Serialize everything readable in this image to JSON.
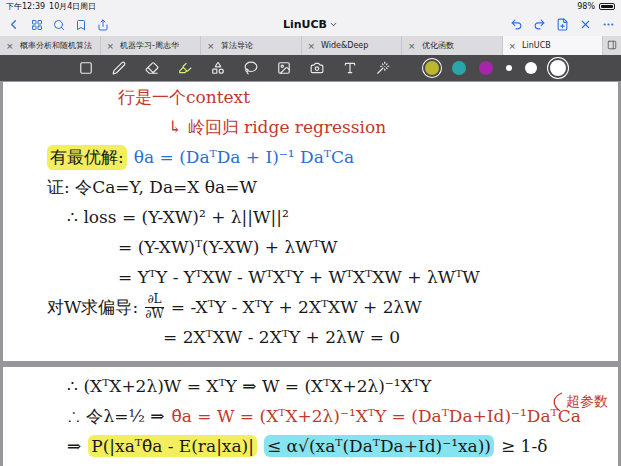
{
  "status_bar": {
    "time": "下午12:39",
    "date": "10月4日周日",
    "battery": "98%",
    "level": 0.98
  },
  "nav": {
    "title": "LinUCB"
  },
  "tab_close": "×",
  "tabs": [
    {
      "label": "概率分析和随机算法",
      "selected": false
    },
    {
      "label": "机器学习-周志华",
      "selected": false
    },
    {
      "label": "算法导论",
      "selected": false
    },
    {
      "label": "Wide&Deep",
      "selected": false
    },
    {
      "label": "优化函数",
      "selected": false
    },
    {
      "label": "LinUCB",
      "selected": true
    }
  ],
  "tools": [
    {
      "kind": "zoom",
      "selected": false
    },
    {
      "kind": "pen",
      "selected": false
    },
    {
      "kind": "eraser",
      "selected": false
    },
    {
      "kind": "highlighter",
      "selected": true
    },
    {
      "kind": "shapes",
      "selected": false
    },
    {
      "kind": "lasso",
      "selected": false
    },
    {
      "kind": "image",
      "selected": false
    },
    {
      "kind": "camera",
      "selected": false
    },
    {
      "kind": "text",
      "selected": false
    },
    {
      "kind": "laser",
      "selected": false
    }
  ],
  "pen_colors": [
    {
      "color": "#bcb52e",
      "selected": true
    },
    {
      "color": "#2aa6aa",
      "selected": false
    },
    {
      "color": "#a526a8",
      "selected": false
    }
  ],
  "pen_widths": [
    {
      "kind": "small",
      "selected": false
    },
    {
      "kind": "medium",
      "selected": false
    },
    {
      "kind": "large",
      "selected": true
    }
  ],
  "pages": [
    {
      "lines": [
        {
          "kind": "cont",
          "segments": [
            {
              "text": "行是一个context",
              "color": "#c0392b"
            }
          ]
        },
        {
          "kind": "note",
          "segments": [
            {
              "text": "↳ 岭回归 ridge regression",
              "color": "#c0392b"
            }
          ]
        },
        {
          "kind": "line",
          "segments": [
            {
              "text": "有最优解:",
              "color": "#1a1a1a",
              "highlight": "#f2ee5e"
            },
            {
              "text": "θa = (DaᵀDa + I)⁻¹ DaᵀCa",
              "color": "#2b6fd0"
            }
          ]
        },
        {
          "kind": "line",
          "segments": [
            {
              "text": "证: 令Ca=Y, Da=X  θa=W",
              "color": "#1a1a1a"
            }
          ]
        },
        {
          "kind": "sub",
          "segments": [
            {
              "text": "∴ loss = (Y-XW)² + λ||W||²",
              "color": "#1a1a1a"
            }
          ]
        },
        {
          "kind": "cont",
          "segments": [
            {
              "text": "= (Y-XW)ᵀ(Y-XW) + λWᵀW",
              "color": "#1a1a1a"
            }
          ]
        },
        {
          "kind": "cont",
          "segments": [
            {
              "text": "= YᵀY - YᵀXW - WᵀXᵀY + WᵀXᵀXW + λWᵀW",
              "color": "#1a1a1a"
            }
          ]
        },
        {
          "kind": "line",
          "segments": [
            {
              "text": "对W求偏导:",
              "color": "#1a1a1a"
            },
            {
              "num": "∂L",
              "den": "∂W",
              "color": "#1a1a1a"
            },
            {
              "text": "= -XᵀY - XᵀY + 2XᵀXW + 2λW",
              "color": "#1a1a1a"
            }
          ]
        },
        {
          "kind": "deep",
          "segments": [
            {
              "text": "= 2XᵀXW - 2XᵀY + 2λW = 0",
              "color": "#1a1a1a"
            }
          ]
        }
      ]
    },
    {
      "annotation": {
        "text": "超参数",
        "color": "#c0392b"
      },
      "lines": [
        {
          "kind": "sub",
          "segments": [
            {
              "text": "∴ (XᵀX+2λ)W = XᵀY  ⇒  W = (XᵀX+2λ)⁻¹XᵀY",
              "color": "#1a1a1a"
            }
          ]
        },
        {
          "kind": "sub",
          "segments": [
            {
              "text": "∴ 令λ=½ ⇒",
              "color": "#1a1a1a"
            },
            {
              "text": "θ̂a = W = (XᵀX+2λ)⁻¹XᵀY = (DaᵀDa+Id)⁻¹DaᵀCa",
              "color": "#c0392b"
            }
          ]
        },
        {
          "kind": "sub",
          "segments": [
            {
              "text": "⇒",
              "color": "#1a1a1a"
            },
            {
              "text": "P(|xaᵀθ̂a - E(ra|xa)|",
              "color": "#1a1a1a",
              "highlight": "#f2ee5e"
            },
            {
              "text": "≤ α√(xaᵀ(DaᵀDa+Id)⁻¹xa))",
              "color": "#1a1a1a",
              "highlight": "#86e3ef"
            },
            {
              "text": "≥ 1-δ",
              "color": "#1a1a1a"
            }
          ]
        }
      ]
    }
  ]
}
